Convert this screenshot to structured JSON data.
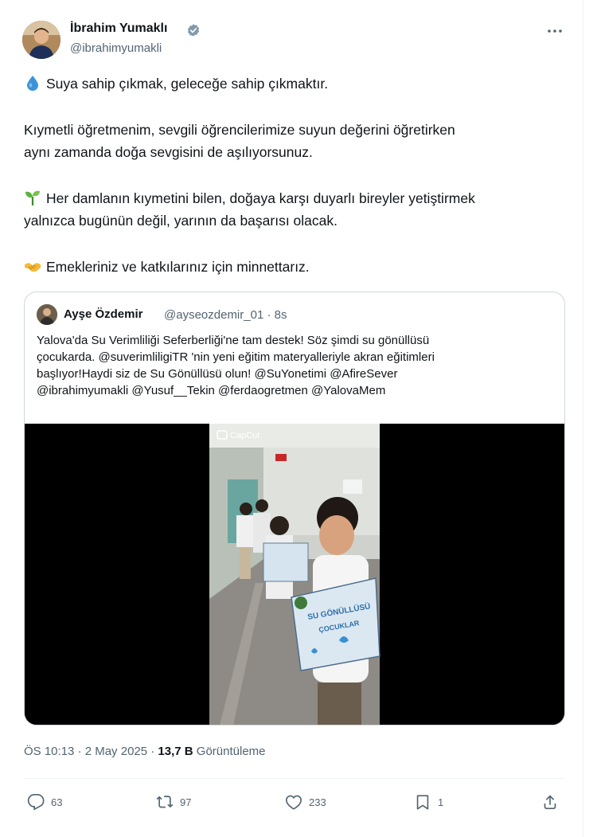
{
  "author": {
    "display_name": "İbrahim Yumaklı",
    "handle": "@ibrahimyumakli",
    "verified": true
  },
  "post": {
    "line1": "Suya sahip çıkmak, geleceğe sahip çıkmaktır.",
    "line2a": "Kıymetli öğretmenim, sevgili öğrencilerimize suyun değerini öğretirken",
    "line2b": "aynı zamanda doğa sevgisini de aşılıyorsunuz.",
    "line3a": "Her damlanın kıymetini bilen, doğaya karşı duyarlı bireyler yetiştirmek",
    "line3b": "yalnızca bugünün değil, yarının da başarısı olacak.",
    "line4": "Emekleriniz ve katkılarınız için minnettarız.",
    "emoji_icons": [
      "droplet-icon",
      "seedling-icon",
      "handshake-icon"
    ]
  },
  "quoted": {
    "name": "Ayşe Özdemir",
    "handle_time": "@ayseozdemir_01 · 8s",
    "lines": [
      "Yalova'da Su Verimliliği Seferberliği'ne tam destek! Söz şimdi su gönüllüsü",
      "çocukarda. @suverimliligiTR 'nin yeni eğitim materyalleriyle akran eğitimleri",
      "başlıyor!Haydi siz de Su Gönüllüsü olun!  @SuYonetimi @AfireSever",
      "@ibrahimyumakli @Yusuf__Tekin @ferdaogretmen @YalovaMem"
    ],
    "video_watermark": "CapCut",
    "sign_text_1": "SU GÖNÜLLÜSÜ",
    "sign_text_2": "ÇOCUKLAR"
  },
  "meta": {
    "time": "ÖS 10:13 · 2 May 2025 · ",
    "views_count": "13,7 B",
    "views_label": " Görüntüleme"
  },
  "actions": {
    "replies": "63",
    "reposts": "97",
    "likes": "233",
    "bookmarks": "1"
  },
  "colors": {
    "text": "#0f1419",
    "secondary": "#536471",
    "verified": "#829aab",
    "border": "#cfd9de"
  }
}
